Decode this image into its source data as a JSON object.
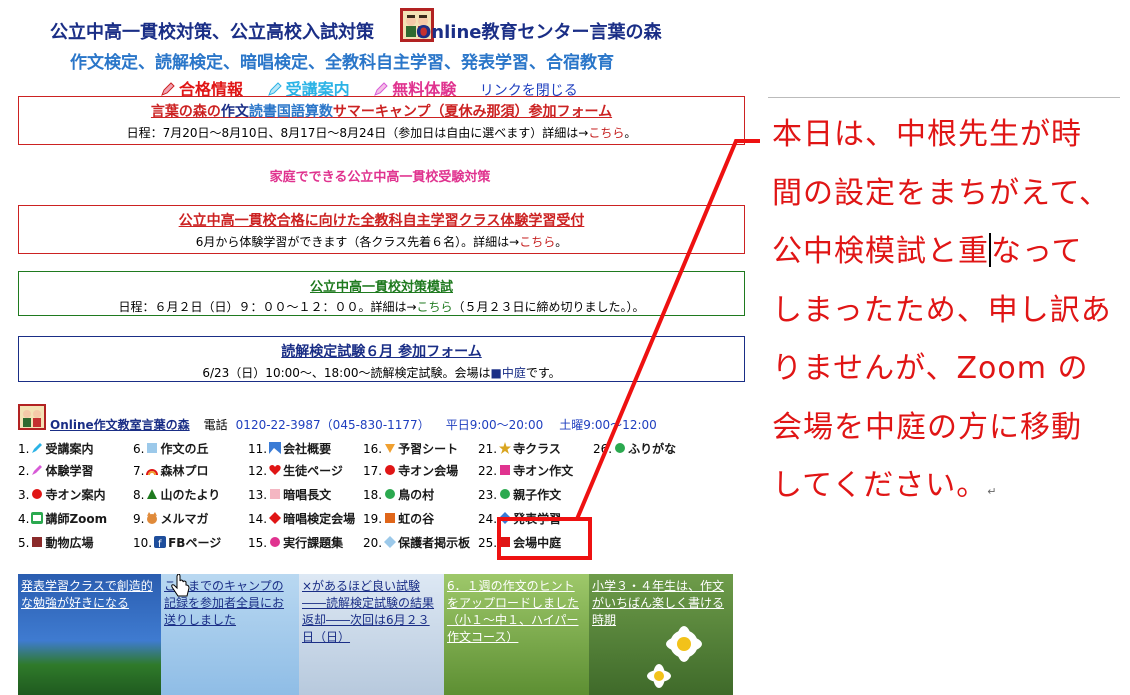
{
  "header": {
    "title_part1": "公立中高一貫校対策、公立高校入試対策",
    "title_part2": "Online教育センター言葉の森",
    "subtitle": "作文検定、読解検定、暗唱検定、全教科自主学習、発表学習、合宿教育",
    "links": [
      {
        "label": "合格情報",
        "color": "#e01515"
      },
      {
        "label": "受講案内",
        "color": "#2bb3e6"
      },
      {
        "label": "無料体験",
        "color": "#e0338f"
      }
    ],
    "close_link": "リンクを閉じる"
  },
  "boxes": {
    "summer": {
      "title_parts": [
        "言葉の森の",
        "作文",
        "読書",
        "国語",
        "算数",
        "サマーキャンプ（夏休み那須）参加フォーム"
      ],
      "desc": "日程：7月20日〜8月10日、8月17日〜8月24日（参加日は自由に選べます）詳細は→",
      "link": "こちら",
      "suffix": "。"
    },
    "home_heading": "家庭でできる公立中高一貫校受験対策",
    "selfstudy": {
      "title": "公立中高一貫校合格に向けた全教科自主学習クラス体験学習受付",
      "desc": "6月から体験学習ができます（各クラス先着６名）。詳細は→",
      "link": "こちら",
      "suffix": "。"
    },
    "mock": {
      "title": "公立中高一貫校対策模試",
      "desc": "日程：６月２日（日）９：００〜１２：００。詳細は→",
      "link": "こちら",
      "suffix": "（５月２３日に締め切りました。）。"
    },
    "reading": {
      "title": "読解検定試験６月 参加フォーム",
      "desc": "6/23（日）10:00〜、18:00〜読解検定試験。会場は",
      "link": "■中庭",
      "suffix": "です。"
    }
  },
  "info": {
    "school": "Online作文教室言葉の森",
    "phone_label": "電話",
    "phone": "0120-22-3987（045-830-1177）",
    "hours_weekday": "平日9:00〜20:00",
    "hours_sat": "土曜9:00〜12:00"
  },
  "grid": [
    {
      "num": "1.",
      "label": "受講案内",
      "icon": "pen-icon",
      "color": "#2bb3e6"
    },
    {
      "num": "2.",
      "label": "体験学習",
      "icon": "pen-icon",
      "color": "#d75ad7"
    },
    {
      "num": "3.",
      "label": "寺オン案内",
      "icon": "dot-icon",
      "color": "#e01515"
    },
    {
      "num": "4.",
      "label": "講師Zoom",
      "icon": "zoom-icon",
      "color": "#2ba94f"
    },
    {
      "num": "5.",
      "label": "動物広場",
      "icon": "square-icon",
      "color": "#8b2a2a"
    },
    {
      "num": "6.",
      "label": "作文の丘",
      "icon": "square-icon",
      "color": "#9cc9ea"
    },
    {
      "num": "7.",
      "label": "森林プロ",
      "icon": "rainbow-icon",
      "color": "#f0a030"
    },
    {
      "num": "8.",
      "label": "山のたより",
      "icon": "triangle-icon",
      "color": "#1f7a1f"
    },
    {
      "num": "9.",
      "label": "メルマガ",
      "icon": "cat-icon",
      "color": "#e08a3a"
    },
    {
      "num": "10.",
      "label": "FBページ",
      "icon": "facebook-icon",
      "color": "#1f4e9c"
    },
    {
      "num": "11.",
      "label": "会社概要",
      "icon": "image-icon",
      "color": "#3a7bd5"
    },
    {
      "num": "12.",
      "label": "生徒ページ",
      "icon": "heart-icon",
      "color": "#e01515"
    },
    {
      "num": "13.",
      "label": "暗唱長文",
      "icon": "square-icon",
      "color": "#f4b6c2"
    },
    {
      "num": "14.",
      "label": "暗唱検定会場",
      "icon": "diamond-icon",
      "color": "#e01515"
    },
    {
      "num": "15.",
      "label": "実行課題集",
      "icon": "dot-icon",
      "color": "#e0338f"
    },
    {
      "num": "16.",
      "label": "予習シート",
      "icon": "triangle-down-icon",
      "color": "#f0a030"
    },
    {
      "num": "17.",
      "label": "寺オン会場",
      "icon": "dot-icon",
      "color": "#e01515"
    },
    {
      "num": "18.",
      "label": "鳥の村",
      "icon": "dot-icon",
      "color": "#2ba94f"
    },
    {
      "num": "19.",
      "label": "虹の谷",
      "icon": "square-icon",
      "color": "#e0661a"
    },
    {
      "num": "20.",
      "label": "保護者掲示板",
      "icon": "diamond-icon",
      "color": "#9cc9ea"
    },
    {
      "num": "21.",
      "label": "寺クラス",
      "icon": "star-icon",
      "color": "#d9a520"
    },
    {
      "num": "22.",
      "label": "寺オン作文",
      "icon": "square-icon",
      "color": "#e0338f"
    },
    {
      "num": "23.",
      "label": "親子作文",
      "icon": "dot-icon",
      "color": "#2ba94f"
    },
    {
      "num": "24.",
      "label": "発表学習",
      "icon": "diamond-icon",
      "color": "#3a7bd5"
    },
    {
      "num": "25.",
      "label": "会場中庭",
      "icon": "square-icon",
      "color": "#e01515"
    },
    {
      "num": "26.",
      "label": "ふりがな",
      "icon": "dot-icon",
      "color": "#2ba94f"
    }
  ],
  "thumbs": [
    {
      "caption": "発表学習クラスで創造的な勉強が好きになる",
      "bg": "#2a5db0"
    },
    {
      "caption": "これまでのキャンプの記録を参加者全員にお送りしました",
      "bg": "#9fc7e8"
    },
    {
      "caption": "×があるほど良い試験――読解検定試験の結果返却――次回は6月２３日（日）",
      "bg": "#c8d8ec"
    },
    {
      "caption": "6．１週の作文のヒントをアップロードしました（小１〜中１、ハイパー作文コース）",
      "bg": "#7fae4a"
    },
    {
      "caption": "小学３・４年生は、作文がいちばん楽しく書ける時期",
      "bg": "#5b8a3a"
    }
  ],
  "notice": {
    "text_before_caret": "本日は、中根先生が時間の設定をまちがえて、公中検模試と重",
    "text_after_caret": "なってしまったため、申し訳ありませんが、Zoom の会場を中庭の方に移動してください。",
    "return_mark": "↵",
    "color": "#e01515"
  }
}
